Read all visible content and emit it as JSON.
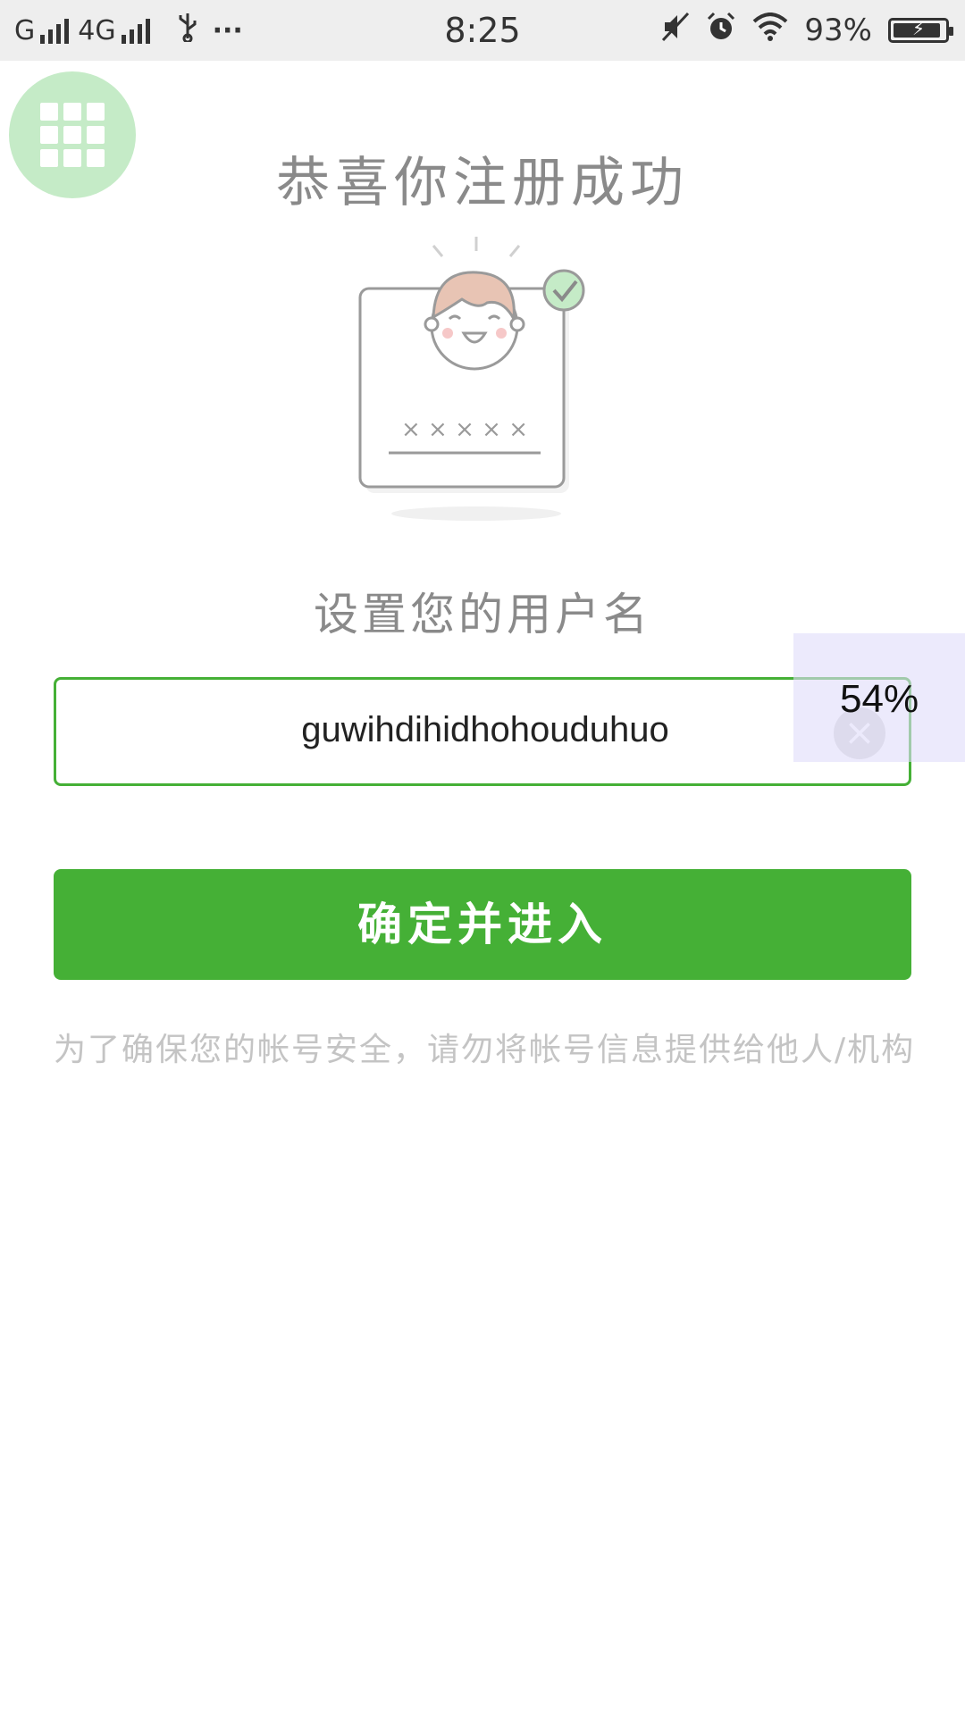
{
  "status_bar": {
    "network1": "G",
    "network2": "4G",
    "dots": "···",
    "time": "8:25",
    "battery_percent": "93%",
    "battery_level": 0.93,
    "icons": [
      "signal-icon",
      "usb-icon",
      "mute-icon",
      "alarm-icon",
      "wifi-icon",
      "battery-icon"
    ]
  },
  "apps_button": {
    "icon": "apps-grid-icon"
  },
  "title": "恭喜你注册成功",
  "illustration": {
    "password_mask": "× × × × ×"
  },
  "subtitle": "设置您的用户名",
  "username_input": {
    "value": "guwihdihidhohouduhuo",
    "clear_icon": "×"
  },
  "overlay": {
    "percent": "54%"
  },
  "confirm_button": {
    "label": "确定并进入"
  },
  "notice": "为了确保您的帐号安全，请勿将帐号信息提供给他人/机构",
  "colors": {
    "accent": "#45b036",
    "fab": "#c5ebc7",
    "text_gray": "#8a8a8a",
    "hint_gray": "#c4c4c4"
  }
}
